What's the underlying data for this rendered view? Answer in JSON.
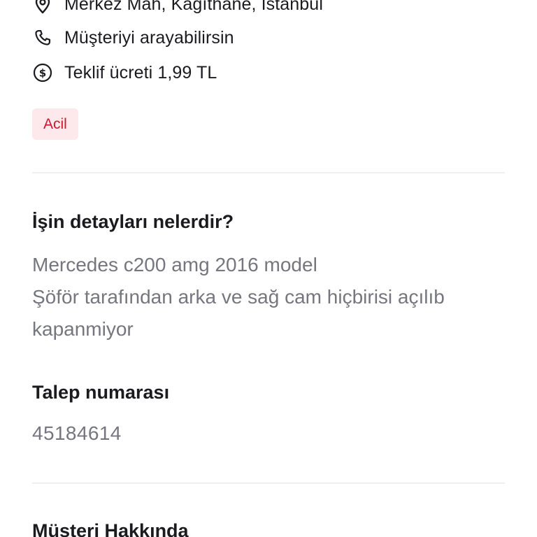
{
  "job_info": {
    "location": "Merkez Mah, Kağıthane, İstanbul",
    "phone_note": "Müşteriyi arayabilirsin",
    "offer_fee": "Teklif ücreti 1,99 TL"
  },
  "badge": {
    "label": "Acil"
  },
  "details_section": {
    "title": "İşin detayları nelerdir?",
    "description": "Mercedes c200 amg 2016 model\nŞöför tarafından arka ve sağ cam hiçbirisi açılıb kapanmiyor"
  },
  "request_section": {
    "title": "Talep numarası",
    "number": "45184614"
  },
  "customer_section": {
    "title": "Müşteri Hakkında"
  },
  "icons": {
    "location": "location-pin-icon",
    "phone": "phone-icon",
    "fee": "dollar-circle-icon"
  },
  "colors": {
    "text_primary": "#1b1b1f",
    "text_secondary": "#76767f",
    "badge_bg": "#fde9ec",
    "badge_text": "#d01630",
    "divider": "#efeff1"
  }
}
